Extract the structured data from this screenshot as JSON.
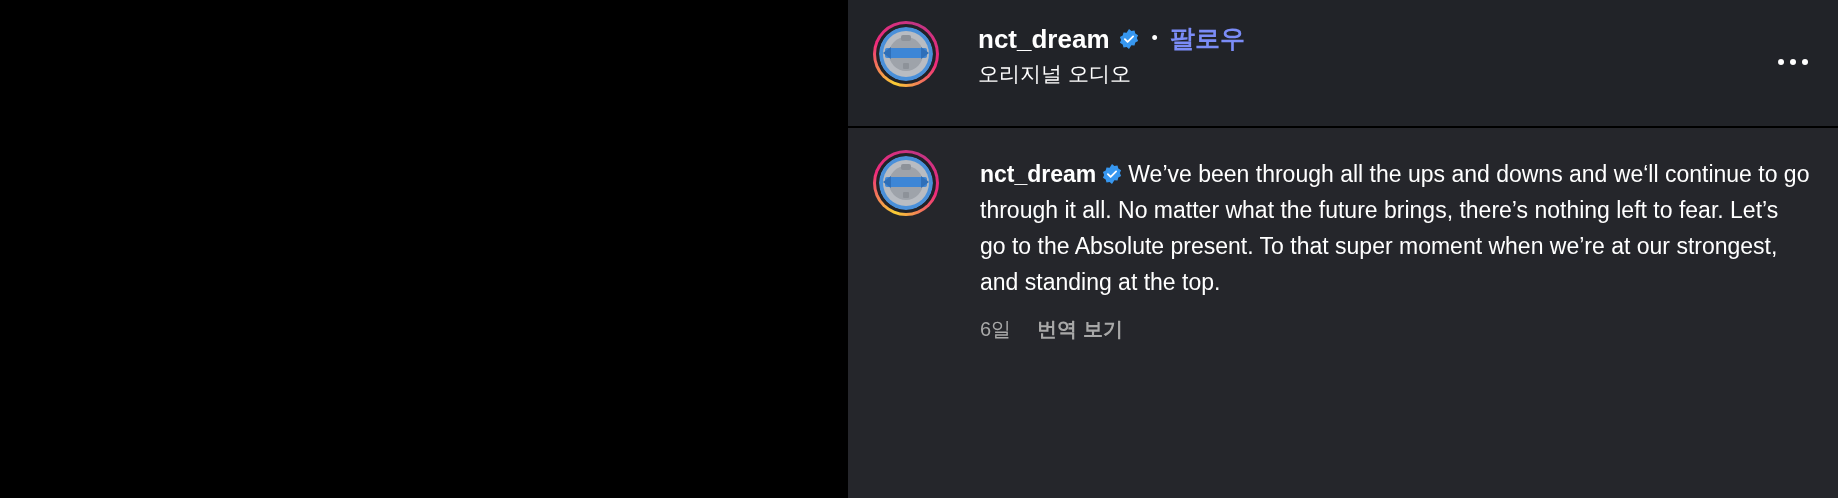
{
  "header": {
    "username": "nct_dream",
    "verified": true,
    "separator": "•",
    "follow": "팔로우",
    "subtitle": "오리지널 오디오"
  },
  "comment": {
    "username": "nct_dream",
    "verified": true,
    "text": "We’ve been through all the ups and downs and we‘ll continue to go through it all. No matter what the future brings, there’s nothing left to fear. Let’s go to the Absolute present. To that super moment when we’re at our strongest, and standing at the top.",
    "time": "6일",
    "translate": "번역 보기"
  }
}
